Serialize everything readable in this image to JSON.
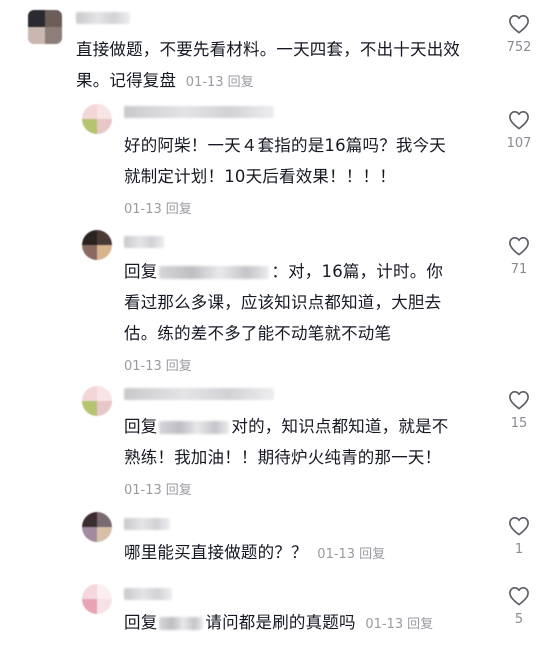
{
  "comments": [
    {
      "text": "直接做题，不要先看材料。一天四套，不出十天出效果。记得复盘",
      "date": "01-13",
      "reply_label": "回复",
      "likes": "752"
    },
    {
      "text_line1": "好的阿柴！一天４套指的是16篇吗？我今天",
      "text_line2": "就制定计划！10天后看效果！！！！",
      "date": "01-13",
      "reply_label": "回复",
      "likes": "107"
    },
    {
      "prefix": "回复",
      "after_name": "：对，16篇，计时。你",
      "text_line2": "看过那么多课，应该知识点都知道，大胆去",
      "text_line3": "估。练的差不多了能不动笔就不动笔",
      "date": "01-13",
      "reply_label": "回复",
      "likes": "71"
    },
    {
      "prefix": "回复",
      "after_name": "对的，知识点都知道，就是不",
      "text_line2": "熟练！我加油！！期待炉火纯青的那一天！",
      "date": "01-13",
      "reply_label": "回复",
      "likes": "15"
    },
    {
      "text": "哪里能买直接做题的？？",
      "date": "01-13",
      "reply_label": "回复",
      "likes": "1"
    },
    {
      "prefix": "回复",
      "after_name": "请问都是刷的真题吗",
      "date": "01-13",
      "reply_label": "回复",
      "likes": "5"
    }
  ],
  "icons": {
    "like": "heart-outline-icon"
  }
}
